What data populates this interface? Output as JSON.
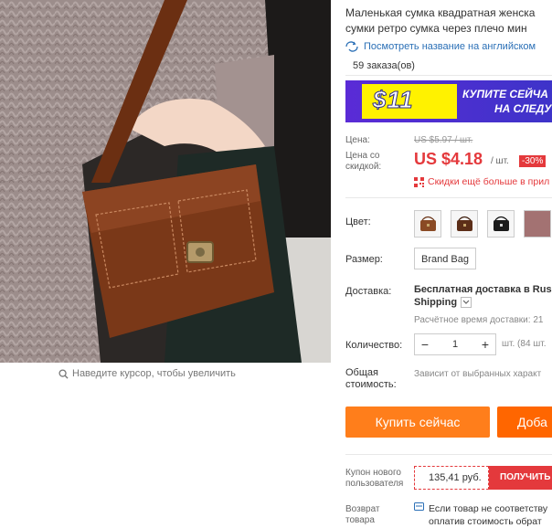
{
  "gallery": {
    "zoom_hint": "Наведите курсор, чтобы увеличить"
  },
  "product": {
    "title_line1": "Маленькая сумка квадратная женска",
    "title_line2": "сумки ретро сумка через плечо мин",
    "translate_link": "Посмотреть название на английском",
    "orders": "59 заказа(ов)"
  },
  "promo": {
    "amount": "$11",
    "line1": "КУПИТЕ СЕЙЧА",
    "line2": "НА СЛЕДУ"
  },
  "price": {
    "label": "Цена:",
    "old": "US $5.97 / шт.",
    "discount_label_1": "Цена со",
    "discount_label_2": "скидкой:",
    "new": "US $4.18",
    "unit": "/ шт.",
    "discount": "-30%",
    "bulk_discount": "Скидки ещё больше в прил"
  },
  "color": {
    "label": "Цвет:",
    "options": [
      "brown-bag",
      "dark-brown-bag",
      "black-bag",
      "pink-swatch"
    ]
  },
  "size": {
    "label": "Размер:",
    "option": "Brand Bag"
  },
  "shipping": {
    "label": "Доставка:",
    "line1": "Бесплатная доставка в Russi",
    "line2": "Shipping",
    "estimate": "Расчётное время доставки: 21"
  },
  "quantity": {
    "label": "Количество:",
    "minus": "−",
    "value": "1",
    "plus": "+",
    "note": "шт. (84 шт."
  },
  "total": {
    "label_1": "Общая",
    "label_2": "стоимость:",
    "note": "Зависит от выбранных характ"
  },
  "actions": {
    "buy_now": "Купить сейчас",
    "add_to_cart": "Доба"
  },
  "coupon": {
    "label_1": "Купон нового",
    "label_2": "пользователя",
    "value": "135,41 руб.",
    "button": "ПОЛУЧИТЬ"
  },
  "returns": {
    "label_1": "Возврат",
    "label_2": "товара",
    "text_1": "Если товар не соответству",
    "text_2": "оплатив стоимость обрат"
  },
  "colors": {
    "accent_red": "#e4393c",
    "buy_orange": "#ff7e1b",
    "link_blue": "#2a6fb6",
    "promo_purple": "#5a2bd6",
    "promo_yellow": "#fff200"
  }
}
